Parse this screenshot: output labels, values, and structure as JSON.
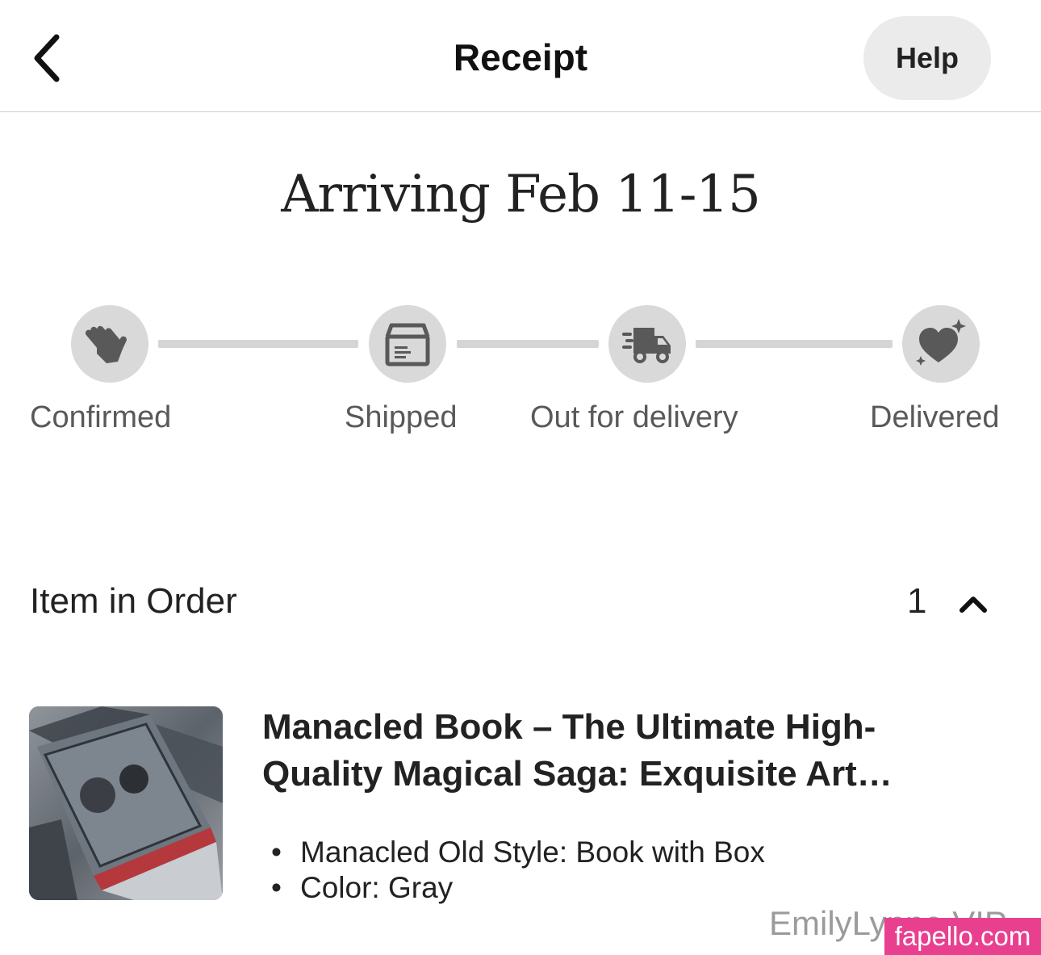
{
  "header": {
    "title": "Receipt",
    "help_label": "Help",
    "back_icon": "chevron-left-icon"
  },
  "status": {
    "arriving": "Arriving Feb 11-15"
  },
  "tracker": {
    "steps": [
      {
        "label": "Confirmed",
        "icon": "waving-hand-icon"
      },
      {
        "label": "Shipped",
        "icon": "package-box-icon"
      },
      {
        "label": "Out for delivery",
        "icon": "delivery-truck-icon"
      },
      {
        "label": "Delivered",
        "icon": "sparkle-heart-icon"
      }
    ],
    "current_step": "Confirmed"
  },
  "order": {
    "section_label": "Item in Order",
    "count": "1",
    "collapse_icon": "chevron-up-icon",
    "item": {
      "title_line1": "Manacled Book – The Ultimate High-",
      "title_line2": "Quality Magical Saga: Exquisite Art…",
      "variations": [
        "Manacled Old Style: Book with Box",
        "Color: Gray"
      ]
    }
  },
  "watermark": {
    "text": "EmilyLynne VIP",
    "badge": "fapello.com",
    "badge_color": "#e8408f"
  },
  "colors": {
    "tracker_inactive": "#d9d9d9",
    "icon_fill": "#595959",
    "text": "#222222"
  }
}
